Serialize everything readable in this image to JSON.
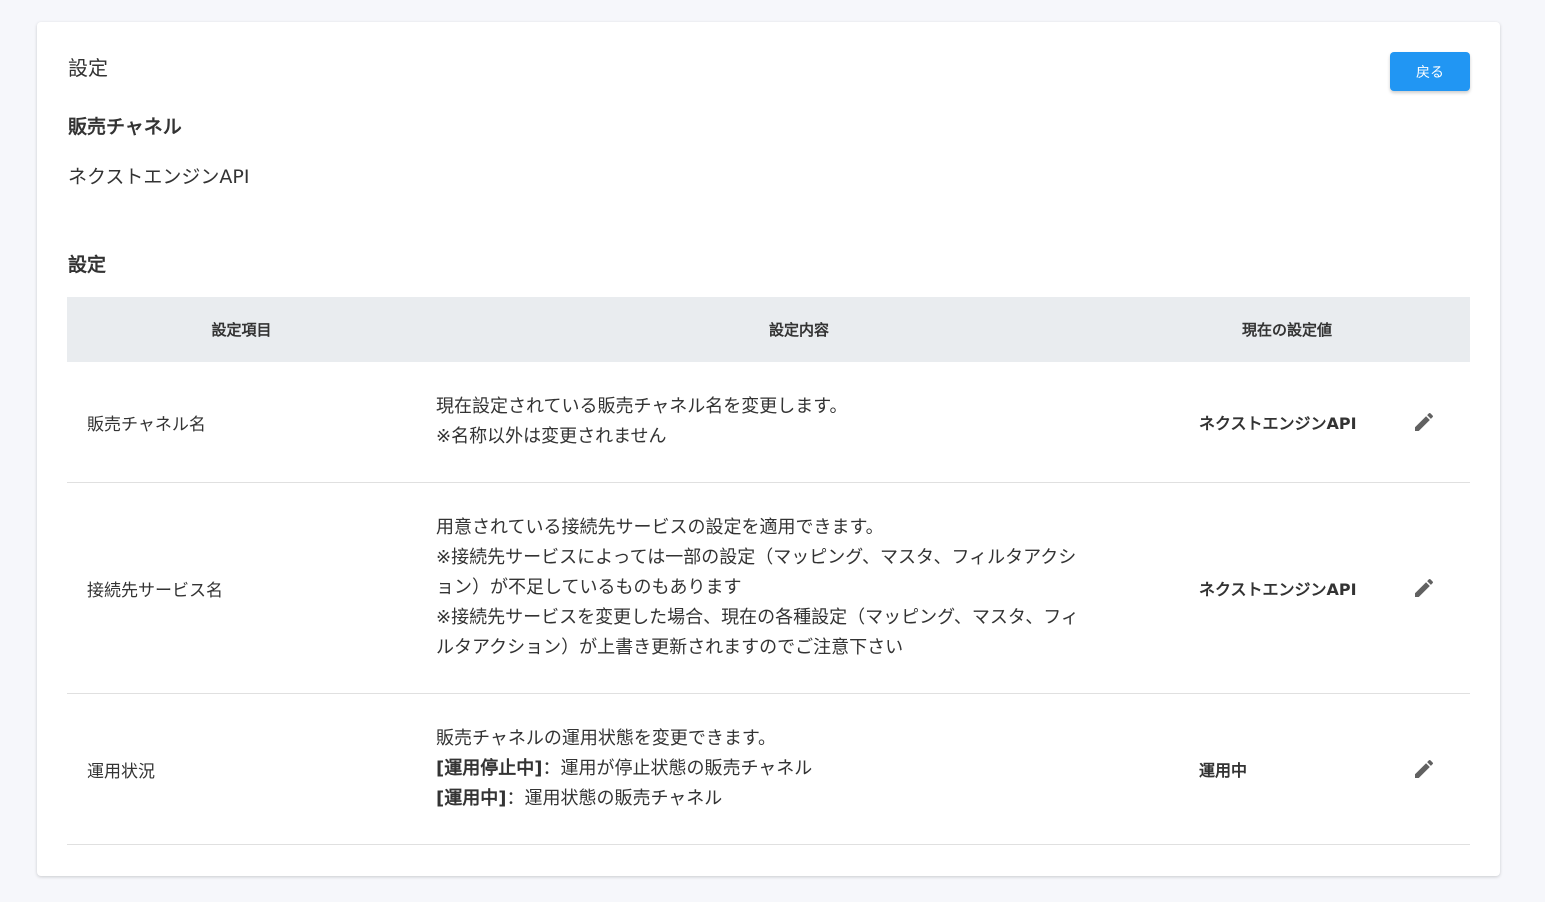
{
  "header": {
    "title": "設定",
    "back_label": "戻る"
  },
  "channel_section": {
    "heading": "販売チャネル",
    "value": "ネクストエンジンAPI"
  },
  "settings_section": {
    "heading": "設定"
  },
  "table": {
    "columns": [
      "設定項目",
      "設定内容",
      "現在の設定値"
    ],
    "rows": [
      {
        "item": "販売チャネル名",
        "desc": [
          "現在設定されている販売チャネル名を変更します。",
          "※名称以外は変更されません"
        ],
        "value": "ネクストエンジンAPI",
        "edit_icon": "pencil-icon"
      },
      {
        "item": "接続先サービス名",
        "desc": [
          "用意されている接続先サービスの設定を適用できます。",
          "※接続先サービスによっては一部の設定（マッピング、マスタ、フィルタアクシ",
          "ョン）が不足しているものもあります",
          "※接続先サービスを変更した場合、現在の各種設定（マッピング、マスタ、フィ",
          "ルタアクション）が上書き更新されますのでご注意下さい"
        ],
        "value": "ネクストエンジンAPI",
        "edit_icon": "pencil-icon"
      },
      {
        "item": "運用状況",
        "desc_intro": "販売チャネルの運用状態を変更できます。",
        "desc_stopped_label": "[運用停止中]",
        "desc_stopped_text": "：運用が停止状態の販売チャネル",
        "desc_active_label": "[運用中]",
        "desc_active_text": "：運用状態の販売チャネル",
        "value": "運用中",
        "edit_icon": "pencil-icon"
      }
    ]
  },
  "colors": {
    "primary": "#2196f3",
    "header_bg": "#e9ecef",
    "icon": "#616161"
  }
}
